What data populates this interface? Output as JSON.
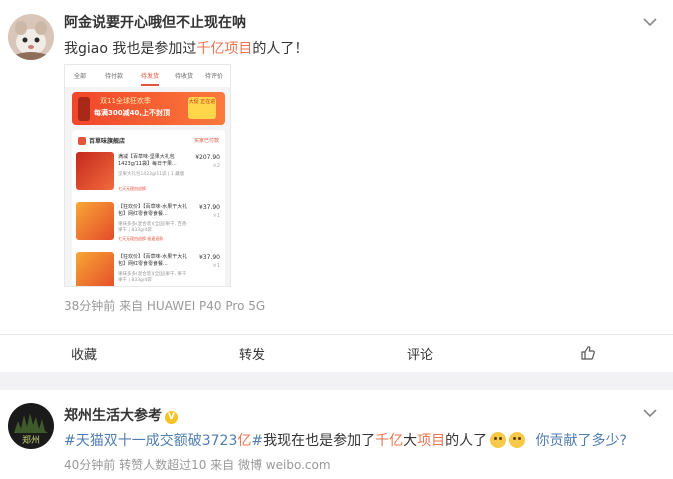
{
  "post1": {
    "username": "阿金说要开心哦但不止现在呐",
    "text_before": "我giao 我也是参加过",
    "text_highlight": "千亿项目",
    "text_after": "的人了！",
    "meta": "38分钟前  来自 HUAWEI P40 Pro 5G",
    "actions": {
      "favorite": "收藏",
      "repost": "转发",
      "comment": "评论"
    },
    "screenshot": {
      "tabs": [
        "全部",
        "待付款",
        "待发货",
        "待收货",
        "待评价"
      ],
      "active_tab": "待发货",
      "banner_line1": "双11全球狂欢季",
      "banner_line2": "每满300减40,上不封顶",
      "banner_badge": "大促 正在进",
      "store_name": "百草味旗舰店",
      "store_status": "买家已付款",
      "items": [
        {
          "title": "满减【百草味-坚果大礼包1423g/11袋】每日干果...",
          "spec": "坚果大礼包1423g/11袋 | 1 藏版",
          "tag": "七天无理由退换",
          "price": "¥207.90",
          "qty": "×2"
        },
        {
          "title": "【狂欢价】【百草味-水果干大礼包】网红零食零食餐...",
          "spec": "果味多多(混合装)[全国]果干, 百香果干 | 833g/4袋",
          "tag": "七天无理由退换  极速退款",
          "price": "¥37.90",
          "qty": "×1"
        },
        {
          "title": "【狂欢价】【百草味-水果干大礼包】网红零食零食餐...",
          "spec": "果味多多(混合装)[全国]果干, 果干果干 | 833g/4袋",
          "tag": "",
          "price": "¥37.90",
          "qty": "×1"
        }
      ]
    }
  },
  "post2": {
    "username": "郑州生活大参考",
    "avatar_text": "郑州",
    "hashtag_a": "#天猫双十一成交额破3723",
    "hashtag_red": "亿",
    "hashtag_b": "#",
    "text_mid": "我现在也是参加了",
    "text_red1": "千亿",
    "text_mid2": "大",
    "text_red2": "项目",
    "text_after": "的人了",
    "text_question": "你贡献了多少?",
    "meta": "40分钟前  转赞人数超过10  来自 微博 weibo.com"
  },
  "colors": {
    "accent": "#eb7350",
    "link": "#507daf",
    "verified": "#f6c324"
  }
}
